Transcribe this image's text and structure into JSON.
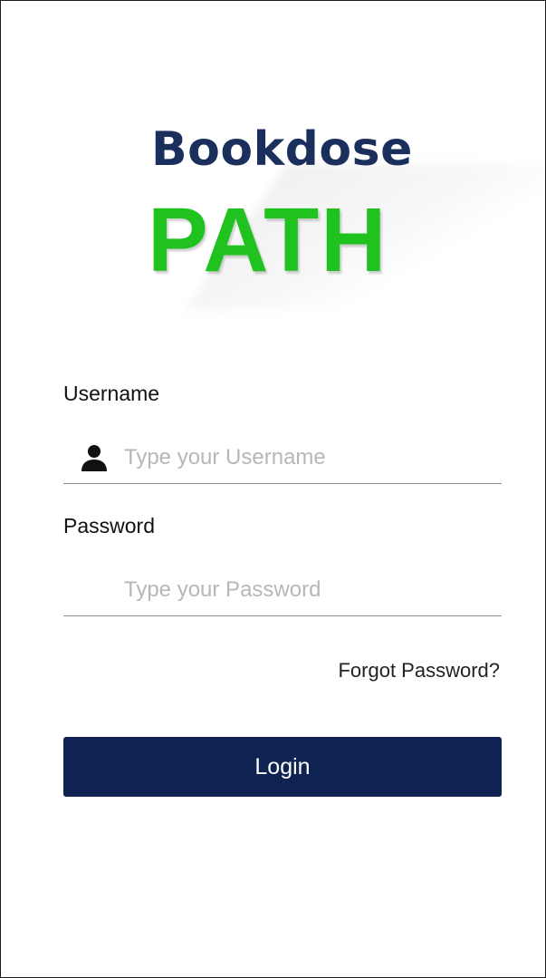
{
  "logo": {
    "top_text": "Bookdose",
    "bottom_text": "PATH",
    "top_color": "#1b2f5c",
    "bottom_color": "#1fc21f"
  },
  "username": {
    "label": "Username",
    "placeholder": "Type your Username",
    "value": "",
    "icon": "user-icon"
  },
  "password": {
    "label": "Password",
    "placeholder": "Type your Password",
    "value": ""
  },
  "forgot_password": {
    "label": "Forgot Password?"
  },
  "login_button": {
    "label": "Login",
    "color": "#0e2351"
  }
}
